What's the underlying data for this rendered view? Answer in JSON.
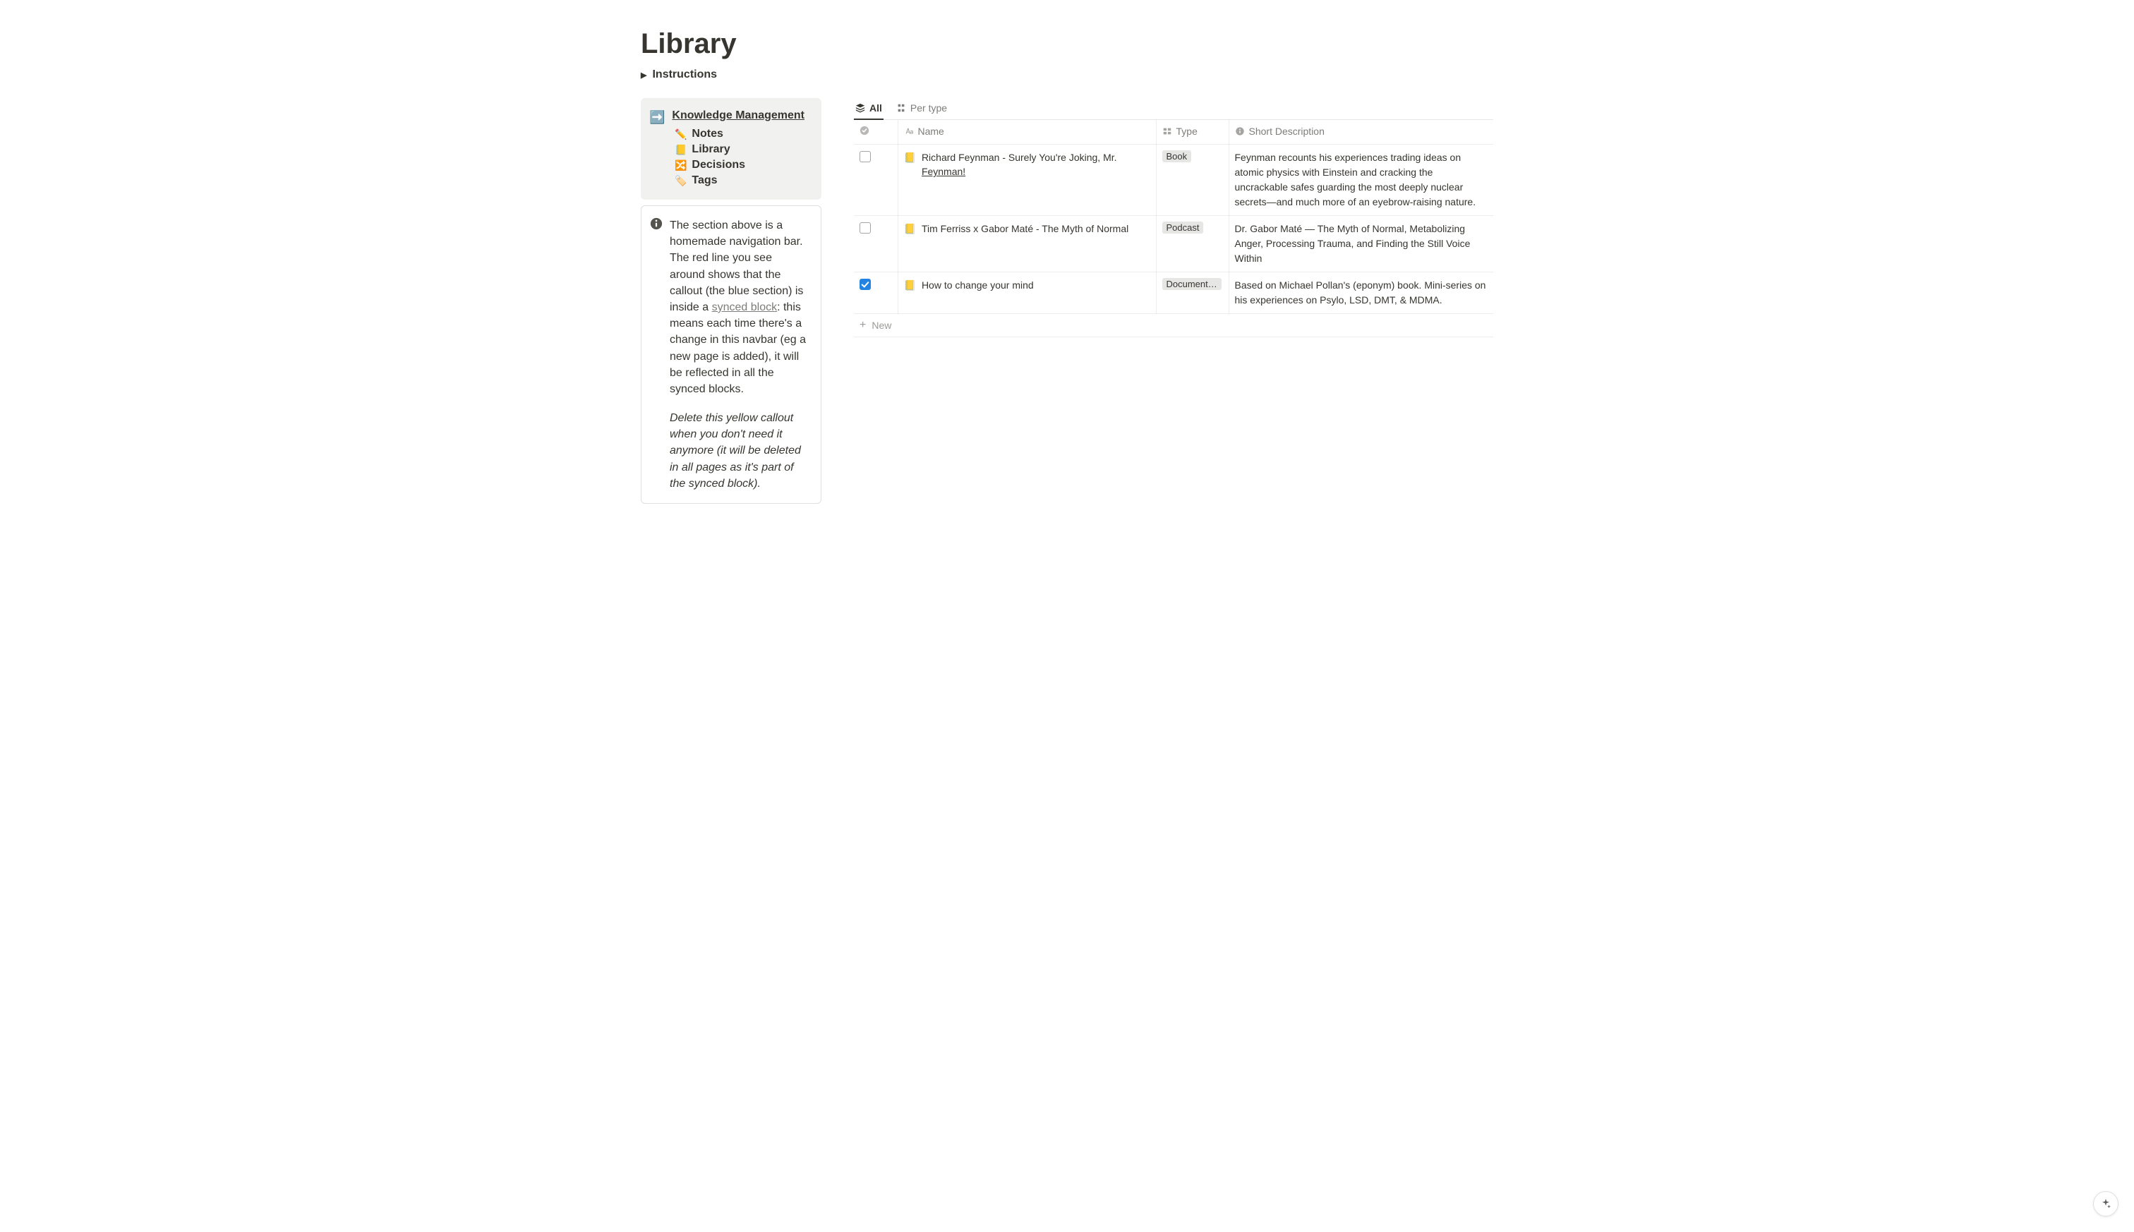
{
  "page": {
    "title": "Library"
  },
  "toggle": {
    "instructions": "Instructions"
  },
  "sidebar": {
    "heading": "Knowledge Management",
    "items": [
      {
        "icon": "✏️",
        "label": "Notes"
      },
      {
        "icon": "📒",
        "label": "Library"
      },
      {
        "icon": "🔀",
        "label": "Decisions"
      },
      {
        "icon": "🏷️",
        "label": "Tags"
      }
    ]
  },
  "callout": {
    "para1_a": "The section above is a homemade navigation bar. The red line you see around shows that the callout (the blue section) is inside a ",
    "synced_link": "synced block",
    "para1_b": ": this means each time there's a change in this navbar (eg a new page is added), it will be reflected in all the synced blocks.",
    "para2": "Delete this yellow callout when you don't need it anymore (it will be deleted in all pages as it's part of the synced block)."
  },
  "tabs": [
    {
      "label": "All",
      "active": true
    },
    {
      "label": "Per type",
      "active": false
    }
  ],
  "columns": {
    "name": "Name",
    "type": "Type",
    "desc": "Short Description"
  },
  "rows": [
    {
      "checked": false,
      "title_a": "Richard Feynman - Surely You're Joking, Mr. ",
      "title_b": "Feynman!",
      "type": "Book",
      "desc": "Feynman recounts his experiences trading ideas on atomic physics with Einstein and cracking the uncrackable safes guarding the most deeply nuclear secrets—and much more of an eyebrow-raising nature."
    },
    {
      "checked": false,
      "title_a": "Tim Ferriss x Gabor Maté - The Myth of Normal",
      "title_b": "",
      "type": "Podcast",
      "desc": "Dr. Gabor Maté — The Myth of Normal, Metabolizing Anger, Processing Trauma, and Finding the Still Voice Within"
    },
    {
      "checked": true,
      "title_a": "How to change your mind",
      "title_b": "",
      "type": "Document…",
      "desc": "Based on Michael Pollan's (eponym) book. Mini-series on his experiences on Psylo, LSD, DMT, & MDMA."
    }
  ],
  "new_label": "New"
}
